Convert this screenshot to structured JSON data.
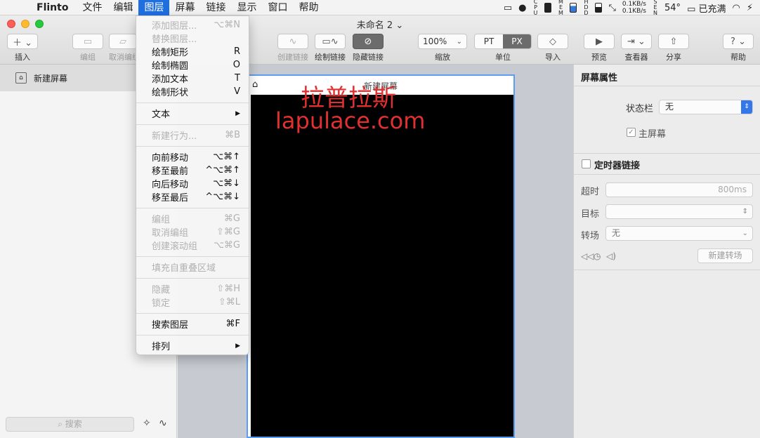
{
  "menubar": {
    "app_name": "Flinto",
    "items": [
      "文件",
      "编辑",
      "图层",
      "屏幕",
      "链接",
      "显示",
      "窗口",
      "帮助"
    ],
    "active_item": "图层",
    "status": {
      "net_up": "0.1KB/s",
      "net_down": "0.1KB/s",
      "temp": "54°",
      "battery_text": "已充满",
      "cpu_label": "CPU",
      "mem_label": "MEM",
      "hdd_label": "HDD",
      "sen_label": "SEN"
    }
  },
  "window": {
    "title": "未命名 2",
    "title_chevron": "⌄"
  },
  "toolbar": {
    "insert": "插入",
    "group": "编组",
    "ungroup": "取消编组",
    "create_link": "创建链接",
    "draw_link": "绘制链接",
    "hide_link": "隐藏链接",
    "zoom_value": "100%",
    "zoom_label": "缩放",
    "unit_pt": "PT",
    "unit_px": "PX",
    "unit_label": "单位",
    "import": "导入",
    "preview": "预览",
    "viewer": "查看器",
    "share": "分享",
    "help": "帮助"
  },
  "sidebar": {
    "screen_item": "新建屏幕",
    "search_placeholder": "搜索"
  },
  "canvas": {
    "artboard_name": "新建屏幕",
    "watermark_cn": "拉普拉斯",
    "watermark_url": "lapulace.com"
  },
  "inspector": {
    "screen_props_title": "屏幕属性",
    "statusbar_label": "状态栏",
    "statusbar_value": "无",
    "home_screen_label": "主屏幕",
    "timer_link_title": "定时器链接",
    "timeout_label": "超时",
    "timeout_value": "800ms",
    "target_label": "目标",
    "target_value": "",
    "transition_label": "转场",
    "transition_value": "无",
    "new_transition_button": "新建转场"
  },
  "layer_menu": {
    "items": [
      {
        "label": "添加图层...",
        "shortcut": "⌥⌘N",
        "disabled": true
      },
      {
        "label": "替换图层...",
        "shortcut": "",
        "disabled": true
      },
      {
        "label": "绘制矩形",
        "shortcut": "R",
        "disabled": false
      },
      {
        "label": "绘制椭圆",
        "shortcut": "O",
        "disabled": false
      },
      {
        "label": "添加文本",
        "shortcut": "T",
        "disabled": false
      },
      {
        "label": "绘制形状",
        "shortcut": "V",
        "disabled": false
      },
      {
        "label": "文本",
        "shortcut": "▶",
        "disabled": false
      },
      {
        "label": "新建行为...",
        "shortcut": "⌘B",
        "disabled": true
      },
      {
        "label": "向前移动",
        "shortcut": "⌥⌘↑",
        "disabled": false
      },
      {
        "label": "移至最前",
        "shortcut": "^⌥⌘↑",
        "disabled": false
      },
      {
        "label": "向后移动",
        "shortcut": "⌥⌘↓",
        "disabled": false
      },
      {
        "label": "移至最后",
        "shortcut": "^⌥⌘↓",
        "disabled": false
      },
      {
        "label": "编组",
        "shortcut": "⌘G",
        "disabled": true
      },
      {
        "label": "取消编组",
        "shortcut": "⇧⌘G",
        "disabled": true
      },
      {
        "label": "创建滚动组",
        "shortcut": "⌥⌘G",
        "disabled": true
      },
      {
        "label": "填充自重叠区域",
        "shortcut": "",
        "disabled": true
      },
      {
        "label": "隐藏",
        "shortcut": "⇧⌘H",
        "disabled": true
      },
      {
        "label": "锁定",
        "shortcut": "⇧⌘L",
        "disabled": true
      },
      {
        "label": "搜索图层",
        "shortcut": "⌘F",
        "disabled": false
      },
      {
        "label": "排列",
        "shortcut": "▶",
        "disabled": false
      }
    ]
  },
  "colors": {
    "accent": "#1f6fe0",
    "watermark": "#e0302f",
    "artboard_border": "#5b9df0"
  }
}
